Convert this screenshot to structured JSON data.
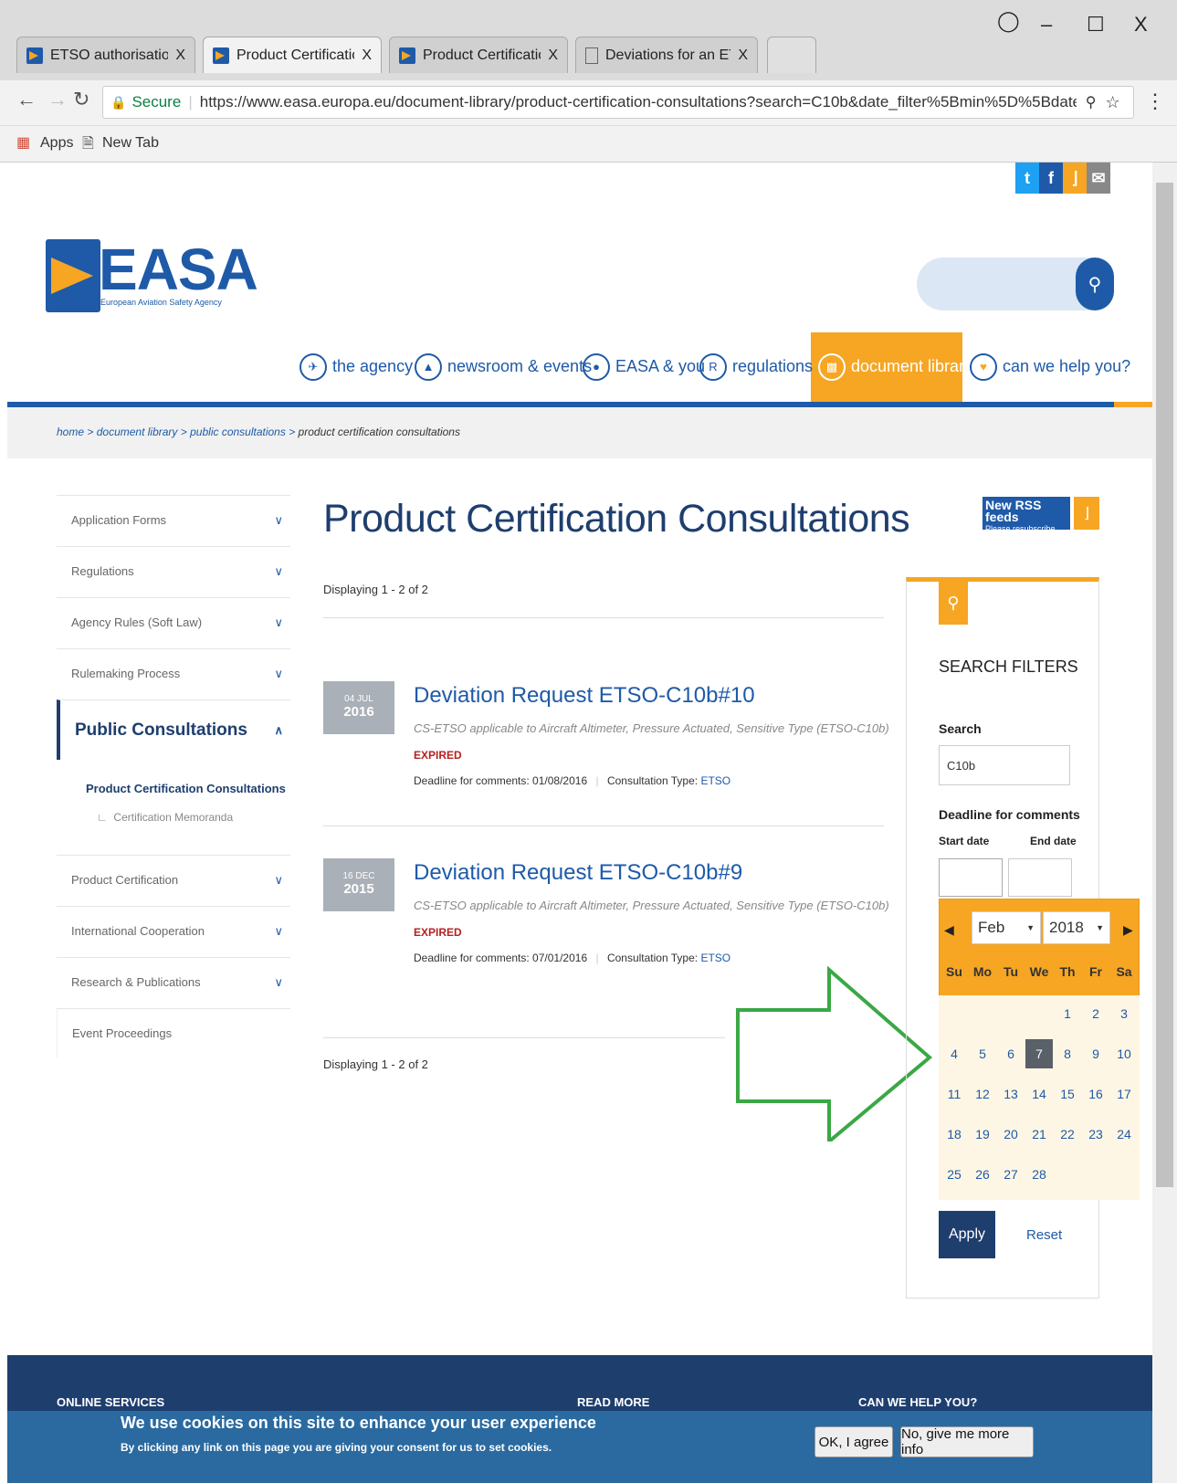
{
  "browser": {
    "tabs": [
      {
        "title": "ETSO authorisations | EA"
      },
      {
        "title": "Product Certification Cor"
      },
      {
        "title": "Product Certification Cor"
      },
      {
        "title": "Deviations for an ETSO –"
      }
    ],
    "secure_label": "Secure",
    "url": "https://www.easa.europa.eu/document-library/product-certification-consultations?search=C10b&date_filter%5Bmin%5D%5Bdate%5D=&date_fil...",
    "bookmarks": {
      "apps": "Apps",
      "new_tab": "New Tab"
    }
  },
  "header": {
    "logo_text": "EASA",
    "logo_sub": "European Aviation Safety Agency",
    "nav": [
      "the agency",
      "newsroom & events",
      "EASA & you",
      "regulations",
      "document library",
      "can we help you?"
    ]
  },
  "breadcrumb": [
    "home",
    "document library",
    "public consultations",
    "product certification consultations"
  ],
  "sidebar": {
    "items": [
      "Application Forms",
      "Regulations",
      "Agency Rules (Soft Law)",
      "Rulemaking Process"
    ],
    "active": "Public Consultations",
    "sub_active": "Product Certification Consultations",
    "sub_child": "Certification Memoranda",
    "items_after": [
      "Product Certification",
      "International Cooperation",
      "Research & Publications",
      "Event Proceedings"
    ]
  },
  "main": {
    "title": "Product Certification Consultations",
    "displaying": "Displaying 1 - 2 of 2",
    "results": [
      {
        "day_month": "04 JUL",
        "year": "2016",
        "title": "Deviation Request ETSO-C10b#10",
        "desc": "CS-ETSO applicable to Aircraft Altimeter, Pressure Actuated, Sensitive Type (ETSO-C10b)",
        "status": "EXPIRED",
        "deadline": "Deadline for comments: 01/08/2016",
        "type_label": "Consultation Type:",
        "type": "ETSO"
      },
      {
        "day_month": "16 DEC",
        "year": "2015",
        "title": "Deviation Request ETSO-C10b#9",
        "desc": "CS-ETSO applicable to Aircraft Altimeter, Pressure Actuated, Sensitive Type (ETSO-C10b)",
        "status": "EXPIRED",
        "deadline": "Deadline for comments: 07/01/2016",
        "type_label": "Consultation Type:",
        "type": "ETSO"
      }
    ]
  },
  "filters": {
    "rss_line1": "New RSS feeds",
    "rss_line2": "Please resubscribe now!",
    "heading": "SEARCH FILTERS",
    "search_label": "Search",
    "search_value": "C10b",
    "deadline_label": "Deadline for comments",
    "start_label": "Start date",
    "end_label": "End date",
    "apply": "Apply",
    "reset": "Reset"
  },
  "calendar": {
    "month": "Feb",
    "year": "2018",
    "weekdays": [
      "Su",
      "Mo",
      "Tu",
      "We",
      "Th",
      "Fr",
      "Sa"
    ],
    "weeks": [
      [
        "",
        "",
        "",
        "",
        "1",
        "2",
        "3"
      ],
      [
        "4",
        "5",
        "6",
        "7",
        "8",
        "9",
        "10"
      ],
      [
        "11",
        "12",
        "13",
        "14",
        "15",
        "16",
        "17"
      ],
      [
        "18",
        "19",
        "20",
        "21",
        "22",
        "23",
        "24"
      ],
      [
        "25",
        "26",
        "27",
        "28",
        "",
        "",
        ""
      ]
    ],
    "selected": "7"
  },
  "footer": {
    "col1": "ONLINE SERVICES",
    "col2": "READ MORE",
    "col3": "CAN WE HELP YOU?"
  },
  "cookie": {
    "title": "We use cookies on this site to enhance your user experience",
    "subtitle": "By clicking any link on this page you are giving your consent for us to set cookies.",
    "ok": "OK, I agree",
    "more": "No, give me more info"
  },
  "colors": {
    "brand_blue": "#1e5aa8",
    "brand_orange": "#f6a623",
    "annotation_arrow": "#3aa845"
  }
}
